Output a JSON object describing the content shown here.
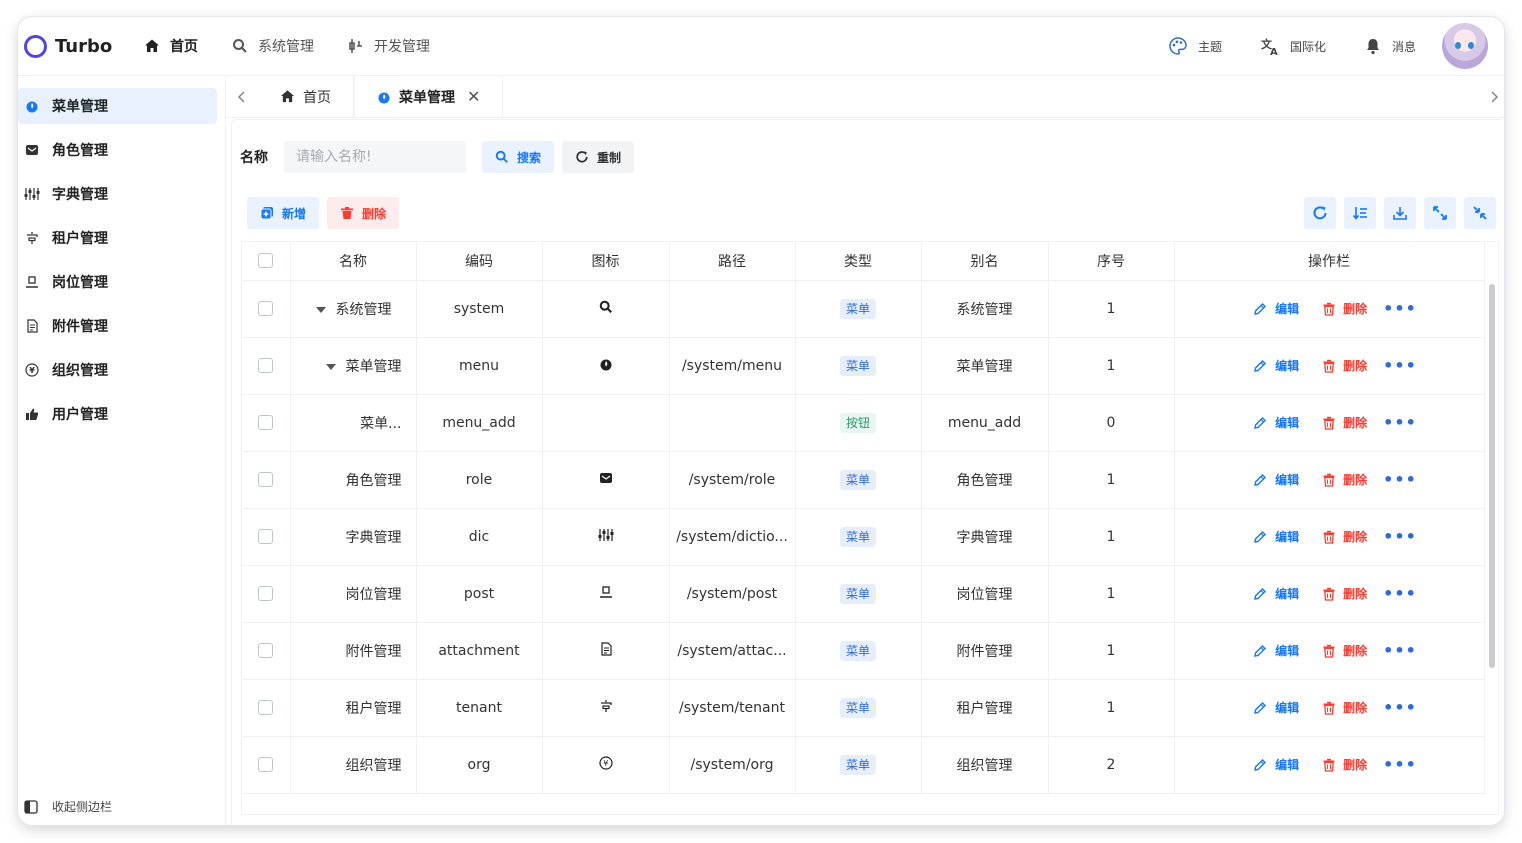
{
  "header": {
    "logo_text": "Turbo",
    "nav": [
      {
        "label": "首页",
        "icon": "home-icon"
      },
      {
        "label": "系统管理",
        "icon": "search-icon"
      },
      {
        "label": "开发管理",
        "icon": "dev-icon"
      }
    ],
    "theme_label": "主题",
    "i18n_label": "国际化",
    "message_label": "消息"
  },
  "sidebar": {
    "items": [
      {
        "label": "菜单管理",
        "icon": "flame-icon"
      },
      {
        "label": "角色管理",
        "icon": "mail-icon"
      },
      {
        "label": "字典管理",
        "icon": "sliders-icon"
      },
      {
        "label": "租户管理",
        "icon": "tenant-icon"
      },
      {
        "label": "岗位管理",
        "icon": "post-icon"
      },
      {
        "label": "附件管理",
        "icon": "file-icon"
      },
      {
        "label": "组织管理",
        "icon": "org-icon"
      },
      {
        "label": "用户管理",
        "icon": "thumbs-up-icon"
      }
    ],
    "collapse_label": "收起侧边栏"
  },
  "tabs": [
    {
      "label": "首页"
    },
    {
      "label": "菜单管理"
    }
  ],
  "search": {
    "label": "名称",
    "placeholder": "请输入名称!",
    "search_label": "搜索",
    "reset_label": "重制"
  },
  "actions": {
    "add_label": "新增",
    "delete_label": "删除"
  },
  "table": {
    "columns": [
      "名称",
      "编码",
      "图标",
      "路径",
      "类型",
      "别名",
      "序号",
      "操作栏"
    ],
    "edit_label": "编辑",
    "delete_label": "删除",
    "more_label": "•••",
    "rows": [
      {
        "name": "系统管理",
        "code": "system",
        "icon": "search-icon",
        "path": "",
        "type": "菜单",
        "alias": "系统管理",
        "order": "1",
        "level": 0,
        "caret": true
      },
      {
        "name": "菜单管理",
        "code": "menu",
        "icon": "flame-icon",
        "path": "/system/menu",
        "type": "菜单",
        "alias": "菜单管理",
        "order": "1",
        "level": 1,
        "caret": true
      },
      {
        "name": "菜单...",
        "code": "menu_add",
        "icon": "",
        "path": "",
        "type": "按钮",
        "alias": "menu_add",
        "order": "0",
        "level": 2,
        "caret": false
      },
      {
        "name": "角色管理",
        "code": "role",
        "icon": "mail-icon",
        "path": "/system/role",
        "type": "菜单",
        "alias": "角色管理",
        "order": "1",
        "level": 1,
        "caret": false
      },
      {
        "name": "字典管理",
        "code": "dic",
        "icon": "sliders-icon",
        "path": "/system/dictio...",
        "type": "菜单",
        "alias": "字典管理",
        "order": "1",
        "level": 1,
        "caret": false
      },
      {
        "name": "岗位管理",
        "code": "post",
        "icon": "post-icon",
        "path": "/system/post",
        "type": "菜单",
        "alias": "岗位管理",
        "order": "1",
        "level": 1,
        "caret": false
      },
      {
        "name": "附件管理",
        "code": "attachment",
        "icon": "file-icon",
        "path": "/system/attac...",
        "type": "菜单",
        "alias": "附件管理",
        "order": "1",
        "level": 1,
        "caret": false
      },
      {
        "name": "租户管理",
        "code": "tenant",
        "icon": "tenant-icon",
        "path": "/system/tenant",
        "type": "菜单",
        "alias": "租户管理",
        "order": "1",
        "level": 1,
        "caret": false
      },
      {
        "name": "组织管理",
        "code": "org",
        "icon": "org-icon",
        "path": "/system/org",
        "type": "菜单",
        "alias": "组织管理",
        "order": "2",
        "level": 1,
        "caret": false
      }
    ]
  },
  "colors": {
    "primary": "#1677ff",
    "danger": "#ff3b30",
    "brand": "#4f46e5",
    "active_bg": "#e8f1fd"
  }
}
